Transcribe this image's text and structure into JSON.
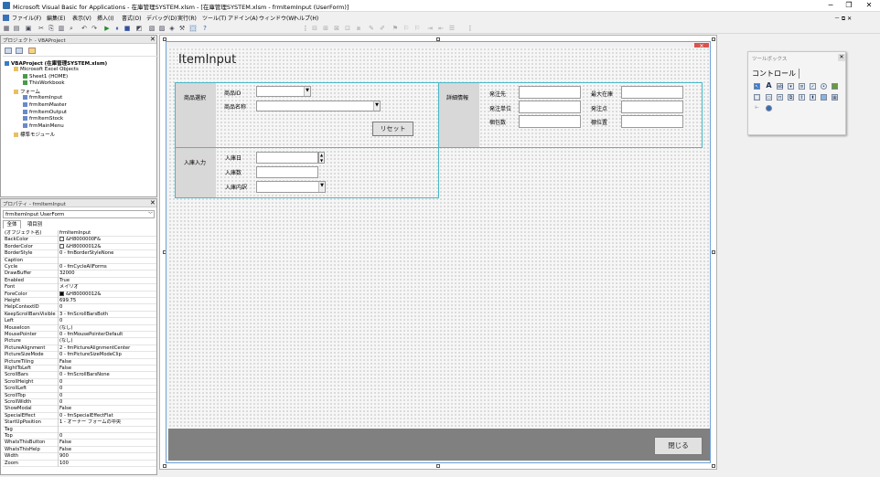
{
  "window": {
    "title": "Microsoft Visual Basic for Applications - 在庫管理SYSTEM.xlsm - [在庫管理SYSTEM.xlsm - frmItemInput (UserForm)]"
  },
  "menu": [
    "ファイル(F)",
    "編集(E)",
    "表示(V)",
    "挿入(I)",
    "書式(O)",
    "デバッグ(D)",
    "実行(R)",
    "ツール(T)",
    "アドイン(A)",
    "ウィンドウ(W)",
    "ヘルプ(H)"
  ],
  "project": {
    "header": "プロジェクト - VBAProject",
    "items": [
      {
        "label": "VBAProject (在庫管理SYSTEM.xlsm)",
        "level": 0,
        "icon": "project-icon"
      },
      {
        "label": "Microsoft Excel Objects",
        "level": 1,
        "icon": "folder-icon"
      },
      {
        "label": "Sheet1 (HOME)",
        "level": 2,
        "icon": "sheet-icon"
      },
      {
        "label": "ThisWorkbook",
        "level": 2,
        "icon": "workbook-icon"
      },
      {
        "label": "フォーム",
        "level": 1,
        "icon": "folder-icon"
      },
      {
        "label": "frmItemInput",
        "level": 2,
        "icon": "form-icon"
      },
      {
        "label": "frmItemMaster",
        "level": 2,
        "icon": "form-icon"
      },
      {
        "label": "frmItemOutput",
        "level": 2,
        "icon": "form-icon"
      },
      {
        "label": "frmItemStock",
        "level": 2,
        "icon": "form-icon"
      },
      {
        "label": "frmMainMenu",
        "level": 2,
        "icon": "form-icon"
      },
      {
        "label": "標準モジュール",
        "level": 1,
        "icon": "folder-icon"
      }
    ]
  },
  "properties": {
    "header": "プロパティ - frmItemInput",
    "object": "frmItemInput  UserForm",
    "tabs": [
      "全体",
      "項目別"
    ],
    "rows": [
      {
        "k": "(オブジェクト名)",
        "v": "frmItemInput"
      },
      {
        "k": "BackColor",
        "v": "&H8000000F&",
        "sw": "#f0f0f0"
      },
      {
        "k": "BorderColor",
        "v": "&H80000012&",
        "sw": "#f0f0f0"
      },
      {
        "k": "BorderStyle",
        "v": "0 - fmBorderStyleNone"
      },
      {
        "k": "Caption",
        "v": ""
      },
      {
        "k": "Cycle",
        "v": "0 - fmCycleAllForms"
      },
      {
        "k": "DrawBuffer",
        "v": "32000"
      },
      {
        "k": "Enabled",
        "v": "True"
      },
      {
        "k": "Font",
        "v": "メイリオ"
      },
      {
        "k": "ForeColor",
        "v": "&H80000012&",
        "sw": "#000000"
      },
      {
        "k": "Height",
        "v": "699.75"
      },
      {
        "k": "HelpContextID",
        "v": "0"
      },
      {
        "k": "KeepScrollBarsVisible",
        "v": "3 - fmScrollBarsBoth"
      },
      {
        "k": "Left",
        "v": "0"
      },
      {
        "k": "MouseIcon",
        "v": "(なし)"
      },
      {
        "k": "MousePointer",
        "v": "0 - fmMousePointerDefault"
      },
      {
        "k": "Picture",
        "v": "(なし)"
      },
      {
        "k": "PictureAlignment",
        "v": "2 - fmPictureAlignmentCenter"
      },
      {
        "k": "PictureSizeMode",
        "v": "0 - fmPictureSizeModeClip"
      },
      {
        "k": "PictureTiling",
        "v": "False"
      },
      {
        "k": "RightToLeft",
        "v": "False"
      },
      {
        "k": "ScrollBars",
        "v": "0 - fmScrollBarsNone"
      },
      {
        "k": "ScrollHeight",
        "v": "0"
      },
      {
        "k": "ScrollLeft",
        "v": "0"
      },
      {
        "k": "ScrollTop",
        "v": "0"
      },
      {
        "k": "ScrollWidth",
        "v": "0"
      },
      {
        "k": "ShowModal",
        "v": "False"
      },
      {
        "k": "SpecialEffect",
        "v": "0 - fmSpecialEffectFlat"
      },
      {
        "k": "StartUpPosition",
        "v": "1 - オーナー フォームの中央"
      },
      {
        "k": "Tag",
        "v": ""
      },
      {
        "k": "Top",
        "v": "0"
      },
      {
        "k": "WhatsThisButton",
        "v": "False"
      },
      {
        "k": "WhatsThisHelp",
        "v": "False"
      },
      {
        "k": "Width",
        "v": "900"
      },
      {
        "k": "Zoom",
        "v": "100"
      }
    ]
  },
  "form": {
    "caption": "ItemInput",
    "product_section": {
      "label": "商品選択",
      "id_label": "商品ID",
      "name_label": "商品名称",
      "reset_button": "リセット"
    },
    "detail_section": {
      "label": "詳細情報",
      "fields_left": [
        "発注先",
        "発注単位",
        "梱包数"
      ],
      "fields_right": [
        "最大在庫",
        "発注点",
        "棚位置"
      ]
    },
    "entry_section": {
      "label": "入庫入力",
      "date_label": "入庫日",
      "qty_label": "入庫数",
      "reason_label": "入庫内訳"
    },
    "close_button": "閉じる"
  },
  "toolbox": {
    "title": "ツールボックス",
    "tab": "コントロール"
  },
  "colors": {
    "frame_border": "#48b8c8",
    "footer": "#808080"
  }
}
